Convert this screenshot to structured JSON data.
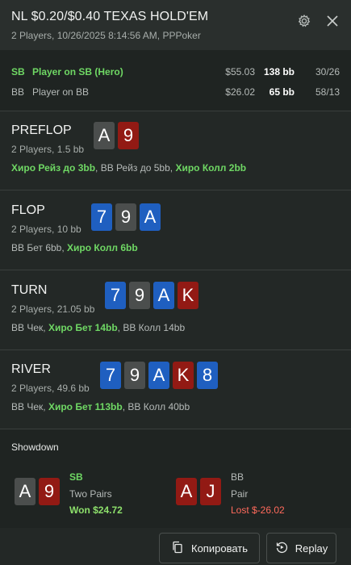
{
  "header": {
    "title": "NL $0.20/$0.40 TEXAS HOLD'EM",
    "subtitle": "2 Players, 10/26/2025 8:14:56 AM, PPPoker",
    "icons": [
      "gear-icon",
      "close-icon"
    ]
  },
  "players": [
    {
      "pos": "SB",
      "name": "Player on SB (Hero)",
      "money": "$55.03",
      "bb": "138 bb",
      "ratio": "30/26"
    },
    {
      "pos": "BB",
      "name": "Player on BB",
      "money": "$26.02",
      "bb": "65 bb",
      "ratio": "58/13"
    }
  ],
  "streets": [
    {
      "name": "PREFLOP",
      "info": "2 Players, 1.5 bb",
      "cards": [
        {
          "rank": "A",
          "color": "gray"
        },
        {
          "rank": "9",
          "color": "red"
        }
      ],
      "actions": [
        {
          "text": "Хиро Рейз до 3bb",
          "hero": true,
          "sep": ", "
        },
        {
          "text": "BB Рейз до 5bb",
          "hero": false,
          "sep": ", "
        },
        {
          "text": "Хиро Колл 2bb",
          "hero": true,
          "sep": ""
        }
      ]
    },
    {
      "name": "FLOP",
      "info": "2 Players, 10 bb",
      "cards": [
        {
          "rank": "7",
          "color": "blue"
        },
        {
          "rank": "9",
          "color": "gray"
        },
        {
          "rank": "A",
          "color": "blue"
        }
      ],
      "actions": [
        {
          "text": "BB Бет 6bb",
          "hero": false,
          "sep": ", "
        },
        {
          "text": "Хиро Колл 6bb",
          "hero": true,
          "sep": ""
        }
      ]
    },
    {
      "name": "TURN",
      "info": "2 Players, 21.05 bb",
      "cards": [
        {
          "rank": "7",
          "color": "blue"
        },
        {
          "rank": "9",
          "color": "gray"
        },
        {
          "rank": "A",
          "color": "blue"
        },
        {
          "rank": "K",
          "color": "red"
        }
      ],
      "actions": [
        {
          "text": "BB Чек",
          "hero": false,
          "sep": ", "
        },
        {
          "text": "Хиро Бет 14bb",
          "hero": true,
          "sep": ", "
        },
        {
          "text": "BB Колл 14bb",
          "hero": false,
          "sep": ""
        }
      ]
    },
    {
      "name": "RIVER",
      "info": "2 Players, 49.6 bb",
      "cards": [
        {
          "rank": "7",
          "color": "blue"
        },
        {
          "rank": "9",
          "color": "gray"
        },
        {
          "rank": "A",
          "color": "blue"
        },
        {
          "rank": "K",
          "color": "red"
        },
        {
          "rank": "8",
          "color": "blue"
        }
      ],
      "actions": [
        {
          "text": "BB Чек",
          "hero": false,
          "sep": ", "
        },
        {
          "text": "Хиро Бет 113bb",
          "hero": true,
          "sep": ", "
        },
        {
          "text": "BB Колл 40bb",
          "hero": false,
          "sep": ""
        }
      ]
    }
  ],
  "showdown": {
    "title": "Showdown",
    "hands": [
      {
        "pos": "SB",
        "combo": "Two Pairs",
        "result": "Won $24.72",
        "won": true,
        "cards": [
          {
            "rank": "A",
            "color": "gray"
          },
          {
            "rank": "9",
            "color": "red"
          }
        ]
      },
      {
        "pos": "BB",
        "combo": "Pair",
        "result": "Lost $-26.02",
        "won": false,
        "cards": [
          {
            "rank": "A",
            "color": "red"
          },
          {
            "rank": "J",
            "color": "red"
          }
        ]
      }
    ]
  },
  "footer": {
    "copy_label": "Копировать",
    "replay_label": "Replay",
    "icons": [
      "copy-icon",
      "replay-icon"
    ]
  },
  "colors": {
    "background": "#232826",
    "hero_green": "#6fd864",
    "won_green": "#8de06b",
    "lost_red": "#ff6a5c",
    "card_gray": "#4b4e4d",
    "card_red": "#921a14",
    "card_blue": "#1f5fc0"
  }
}
